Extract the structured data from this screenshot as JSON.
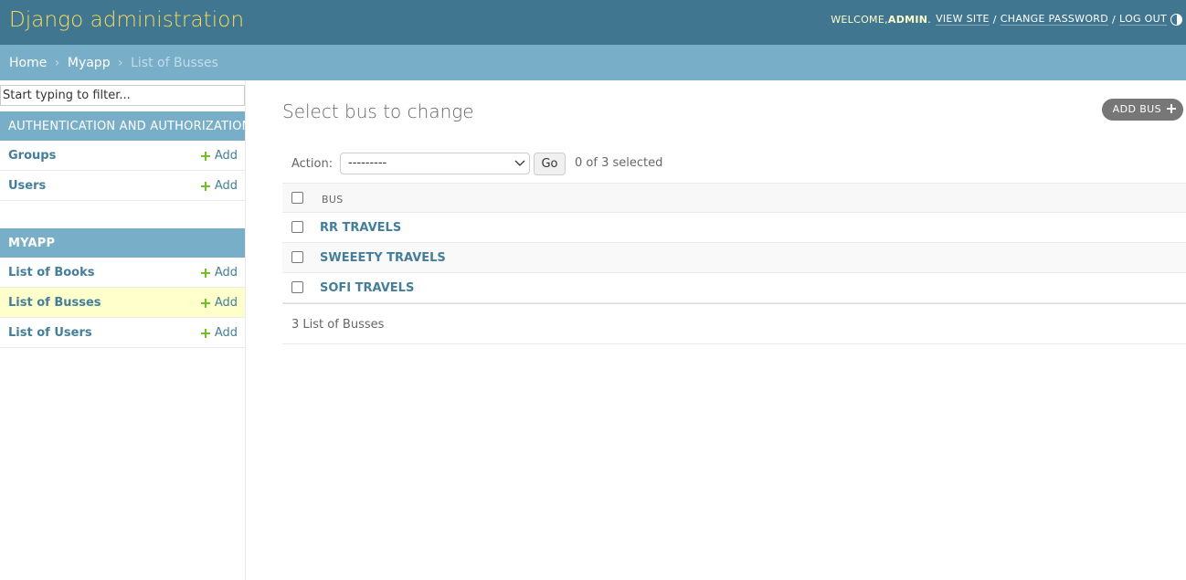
{
  "header": {
    "brand": "Django administration",
    "welcome": "WELCOME, ",
    "username": "ADMIN",
    "period": ".",
    "view_site": "VIEW SITE",
    "change_password": "CHANGE PASSWORD",
    "log_out": "LOG OUT",
    "separator": "/"
  },
  "breadcrumbs": {
    "home": "Home",
    "app": "Myapp",
    "current": "List of Busses",
    "separator": "›"
  },
  "sidebar": {
    "filter_placeholder": "Start typing to filter...",
    "modules": [
      {
        "caption": "AUTHENTICATION AND AUTHORIZATION",
        "items": [
          {
            "label": "Groups",
            "add": "Add"
          },
          {
            "label": "Users",
            "add": "Add"
          }
        ]
      },
      {
        "caption": "MYAPP",
        "items": [
          {
            "label": "List of Books",
            "add": "Add"
          },
          {
            "label": "List of Busses",
            "add": "Add",
            "active": true
          },
          {
            "label": "List of Users",
            "add": "Add"
          }
        ]
      }
    ]
  },
  "content": {
    "title": "Select bus to change",
    "add_button": "ADD BUS",
    "actions": {
      "label": "Action:",
      "selected_value": "---------",
      "go": "Go",
      "counter": "0 of 3 selected"
    },
    "table": {
      "column": "BUS",
      "rows": [
        "RR TRAVELS",
        "SWEEETY TRAVELS",
        "SOFI TRAVELS"
      ]
    },
    "paginator": "3 List of Busses"
  },
  "colors": {
    "header_bg": "#417690",
    "brand": "#f5dd5d",
    "breadcrumb_bg": "#79aec8",
    "link": "#447e9b",
    "add_plus": "#70bf2b",
    "active_row": "#ffffcc"
  }
}
